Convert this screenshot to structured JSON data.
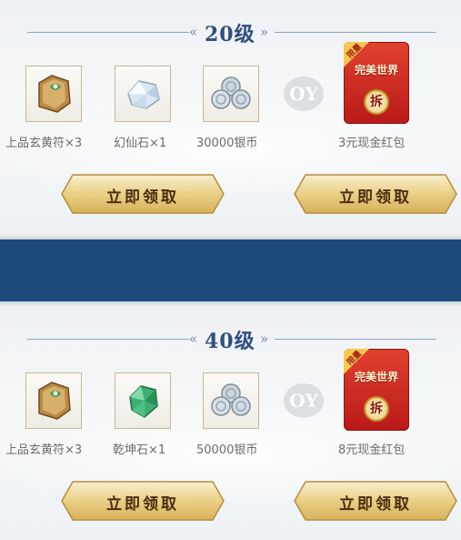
{
  "sections": [
    {
      "level": "20级",
      "items": [
        {
          "icon": "talisman-icon",
          "label": "上品玄黄符×3"
        },
        {
          "icon": "crystal-icon",
          "label": "幻仙石×1"
        },
        {
          "icon": "silver-coins-icon",
          "label": "30000银币"
        }
      ],
      "or_text": "OY",
      "redpack": {
        "tag": "限量",
        "brand": "完美世界",
        "seal": "拆",
        "label": "3元现金红包"
      },
      "buttons": [
        "立即领取",
        "立即领取"
      ]
    },
    {
      "level": "40级",
      "items": [
        {
          "icon": "talisman-icon",
          "label": "上品玄黄符×3"
        },
        {
          "icon": "jade-stone-icon",
          "label": "乾坤石×1"
        },
        {
          "icon": "silver-coins-icon",
          "label": "50000银币"
        }
      ],
      "or_text": "OY",
      "redpack": {
        "tag": "限量",
        "brand": "完美世界",
        "seal": "拆",
        "label": "8元现金红包"
      },
      "buttons": [
        "立即领取",
        "立即领取"
      ]
    }
  ],
  "colors": {
    "band": "#1e4a7a",
    "level": "#2f4f7f",
    "button_gold": "#e9cf85",
    "redpack": "#c8251f"
  }
}
